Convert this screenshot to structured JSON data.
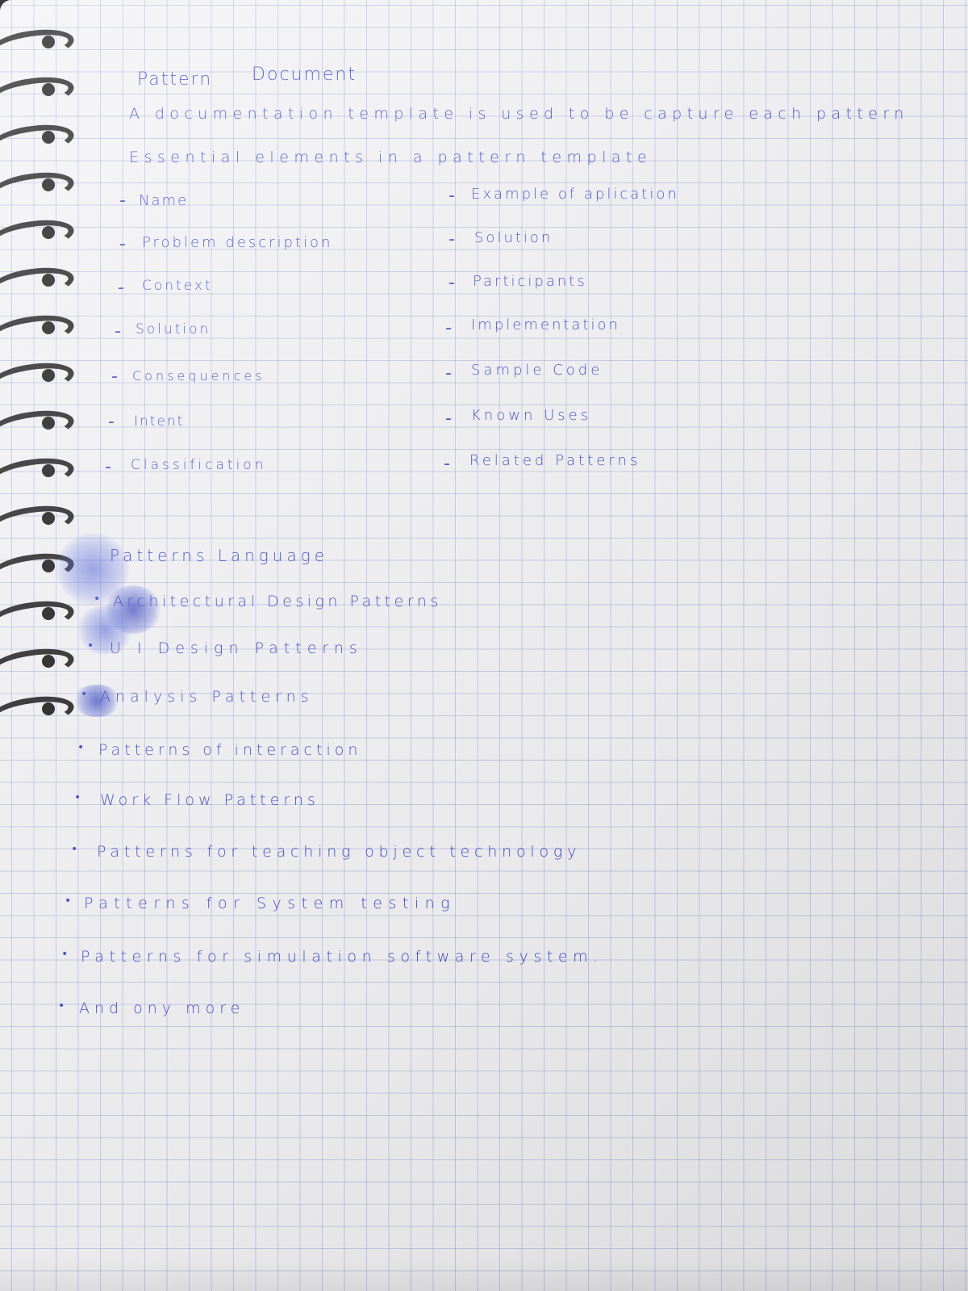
{
  "title": {
    "w1": "Pattern",
    "w2": "Document"
  },
  "intro": "A documentation template is used to be capture each pattern",
  "essential": "Essential elements in a pattern template",
  "left_list": [
    {
      "marker": "-",
      "text": "Name"
    },
    {
      "marker": "-",
      "text": "Problem description"
    },
    {
      "marker": "-",
      "text": "Context"
    },
    {
      "marker": "-",
      "text": "Solution"
    },
    {
      "marker": "-",
      "text": "Consequences"
    },
    {
      "marker": "-",
      "text": "Intent"
    },
    {
      "marker": "-",
      "text": "Classification"
    }
  ],
  "right_list": [
    {
      "marker": "-",
      "text": "Example of aplication"
    },
    {
      "marker": "-",
      "text": "Solution"
    },
    {
      "marker": "-",
      "text": "Participants"
    },
    {
      "marker": "-",
      "text": "Implementation"
    },
    {
      "marker": "-",
      "text": "Sample Code"
    },
    {
      "marker": "-",
      "text": "Known Uses"
    },
    {
      "marker": "-",
      "text": "Related Patterns"
    }
  ],
  "section2_title": "Patterns Language",
  "bullets": [
    {
      "marker": "•",
      "text": "Architectural Design Patterns"
    },
    {
      "marker": "•",
      "text": "U I Design Patterns"
    },
    {
      "marker": "•",
      "text": "Analysis Patterns"
    },
    {
      "marker": "•",
      "text": "Patterns of interaction"
    },
    {
      "marker": "•",
      "text": "Work Flow Patterns"
    },
    {
      "marker": "•",
      "text": "Patterns for teaching object technology"
    },
    {
      "marker": "•",
      "text": "Patterns for System testing"
    },
    {
      "marker": "•",
      "text": "Patterns for simulation software system."
    },
    {
      "marker": "•",
      "text": "And ony more"
    }
  ],
  "ink_color": "#3f4bc2",
  "grid_color": "#8c95d4",
  "paper_color": "#f3f3f6",
  "ring_color": "#262626"
}
